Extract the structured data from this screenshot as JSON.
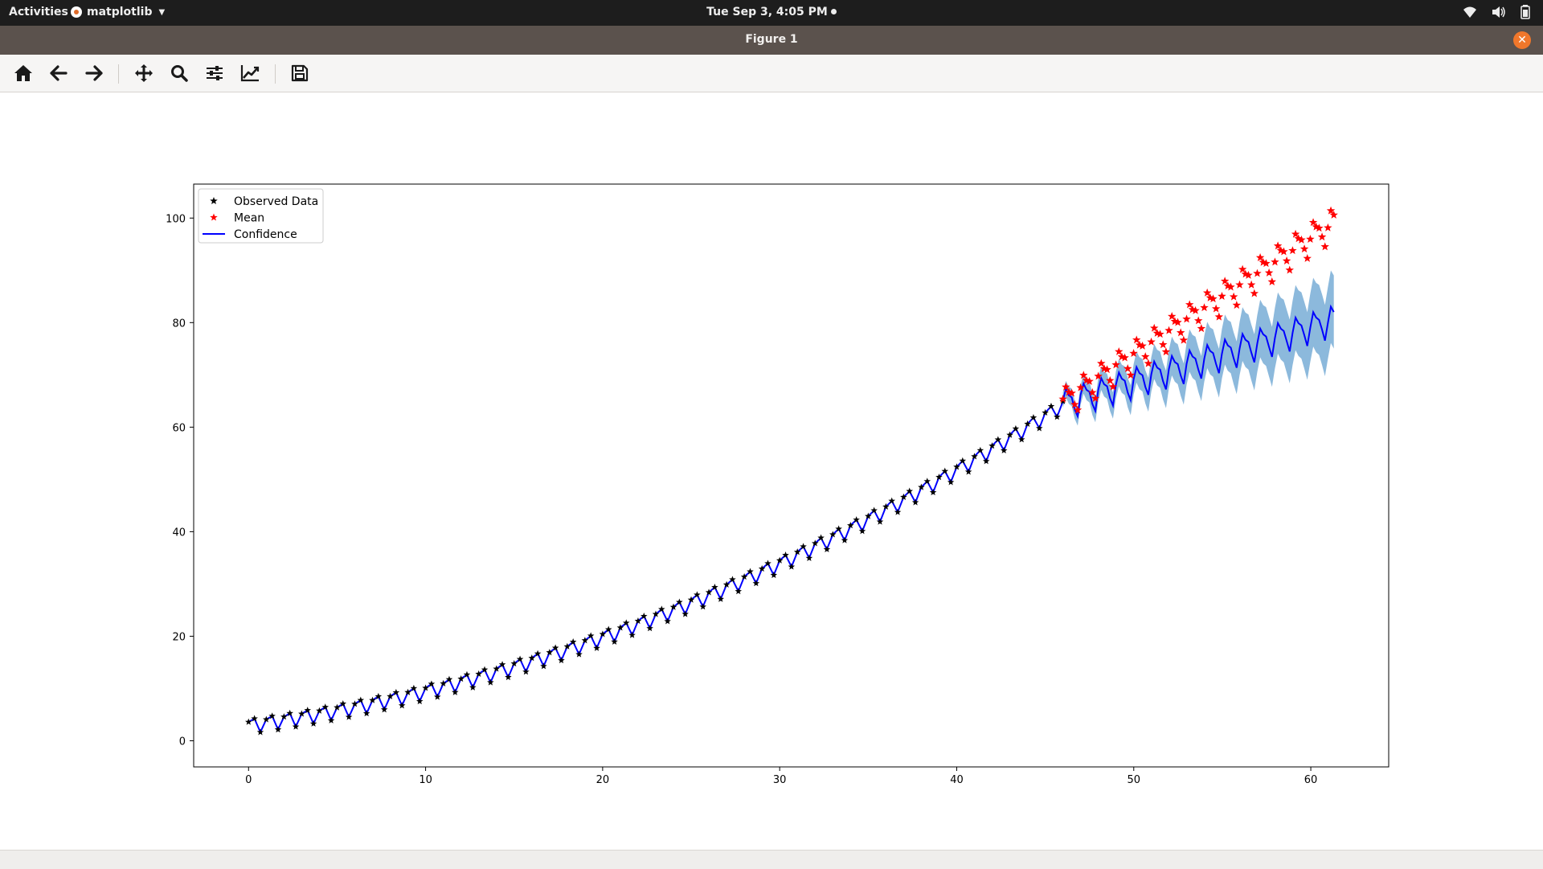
{
  "topbar": {
    "activities": "Activities",
    "app_name": "matplotlib",
    "clock": "Tue Sep  3,  4:05 PM",
    "icons": [
      "wifi-icon",
      "volume-icon",
      "battery-icon"
    ]
  },
  "window": {
    "title": "Figure 1",
    "close_icon": "close-icon"
  },
  "toolbar": {
    "buttons": [
      "home-icon",
      "back-icon",
      "forward-icon",
      "pan-icon",
      "zoom-icon",
      "configure-subplots-icon",
      "edit-axes-icon",
      "save-icon"
    ]
  },
  "chart_data": {
    "type": "line",
    "title": "",
    "xlabel": "",
    "ylabel": "",
    "xlim": [
      -3.1,
      64.4
    ],
    "ylim": [
      -5,
      106.5
    ],
    "xticks": [
      0,
      10,
      20,
      30,
      40,
      50,
      60
    ],
    "yticks": [
      0,
      20,
      40,
      60,
      80,
      100
    ],
    "grid": false,
    "legend_position": "top-left",
    "colors": {
      "observed": "#000000",
      "mean": "#ff0000",
      "confidence_line": "#0000ff",
      "confidence_band": "#8cb9dc"
    },
    "observed_model": {
      "x_start": 0,
      "x_end": 46,
      "samples_per_unit": 3,
      "trend_quadratic": [
        3.0,
        0.46,
        0.019
      ],
      "seasonal_amplitude": 2.3,
      "seasonal_period": 1.0
    },
    "forecast_model": {
      "x_start": 46,
      "x_end": 61.3,
      "mean_stars": {
        "start_value": 64.7,
        "slope": 2.25,
        "amplitude": 2.6
      },
      "confidence_line": {
        "start_value": 64.5,
        "slope": 1.05,
        "amplitude": 2.6
      },
      "band_halfwidth_start": 1.5,
      "band_halfwidth_end": 7.0
    },
    "series": [
      {
        "name": "Observed Data",
        "marker": "star",
        "color": "#000000"
      },
      {
        "name": "Mean",
        "marker": "star",
        "color": "#ff0000"
      },
      {
        "name": "Confidence",
        "marker": "line",
        "color": "#0000ff"
      }
    ]
  }
}
